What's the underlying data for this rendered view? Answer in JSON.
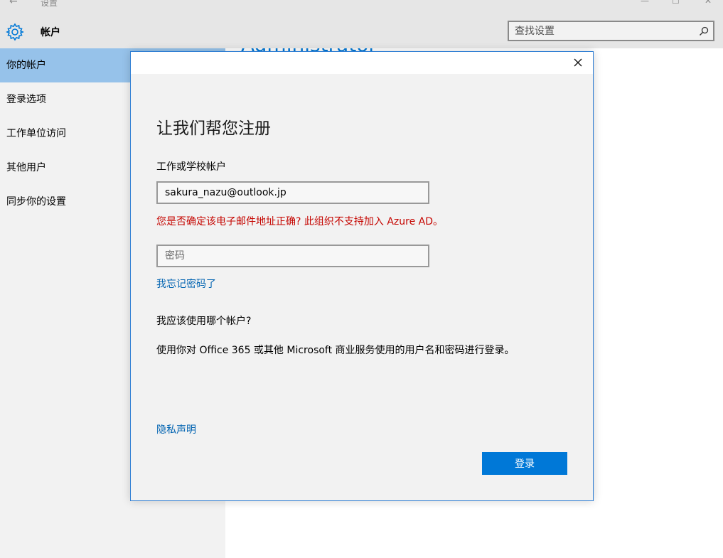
{
  "window": {
    "back_glyph": "←",
    "title": "设置",
    "minimize_glyph": "—",
    "maximize_glyph": "☐",
    "close_glyph": "✕"
  },
  "header": {
    "icon": "gear-icon",
    "title": "帐户",
    "search_placeholder": "查找设置",
    "search_icon": "search-icon"
  },
  "sidebar": {
    "items": [
      {
        "label": "你的帐户",
        "active": true
      },
      {
        "label": "登录选项",
        "active": false
      },
      {
        "label": "工作单位访问",
        "active": false
      },
      {
        "label": "其他用户",
        "active": false
      },
      {
        "label": "同步你的设置",
        "active": false
      }
    ]
  },
  "main": {
    "heading": "Administrator"
  },
  "dialog": {
    "title": "让我们帮您注册",
    "account_label": "工作或学校帐户",
    "email_value": "sakura_nazu@outlook.jp",
    "error": "您是否确定该电子邮件地址正确? 此组织不支持加入 Azure AD。",
    "password_placeholder": "密码",
    "forgot_link": "我忘记密码了",
    "which_account": "我应该使用哪个帐户?",
    "info": "使用你对 Office 365 或其他 Microsoft 商业服务使用的用户名和密码进行登录。",
    "privacy_link": "隐私声明",
    "signin_button": "登录"
  },
  "colors": {
    "accent": "#0078d7",
    "link": "#0063b1",
    "error": "#c50500",
    "sidebar_active": "#96c2ea",
    "chrome": "#e6e6e6"
  }
}
